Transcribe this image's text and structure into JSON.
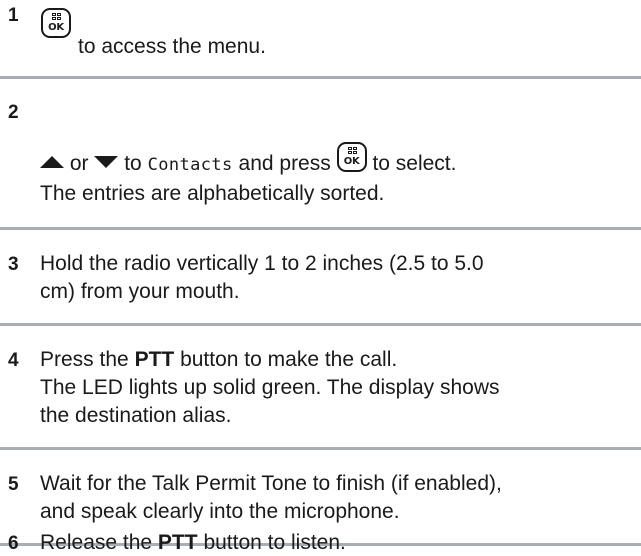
{
  "steps": [
    {
      "number": "1",
      "text_after_key": "to access the menu."
    },
    {
      "number": "2",
      "word_or": "or",
      "word_to": "to",
      "menu_item": "Contacts",
      "word_and_press": "and press",
      "word_to_select": "to select.",
      "note": "The entries are alphabetically sorted."
    },
    {
      "number": "3",
      "line1": "Hold the radio vertically 1 to 2 inches (2.5 to 5.0",
      "line2": "cm) from your mouth."
    },
    {
      "number": "4",
      "line1_pre": "Press the",
      "line1_bold": "PTT",
      "line1_post": "button to make the call.",
      "line2": "The LED lights up solid green. The display shows",
      "line3": "the destination alias."
    },
    {
      "number": "5",
      "line1": "Wait for the Talk Permit Tone to finish (if enabled),",
      "line2": "and speak clearly into the microphone."
    },
    {
      "number": "6",
      "line1_pre": "Release the",
      "line1_bold": "PTT",
      "line1_post": "button to listen."
    }
  ],
  "key": {
    "ok_label": "OK",
    "icon": "menu-ok-key-icon"
  },
  "colors": {
    "divider": "#a7aeb5",
    "text": "#1a1a1a"
  }
}
